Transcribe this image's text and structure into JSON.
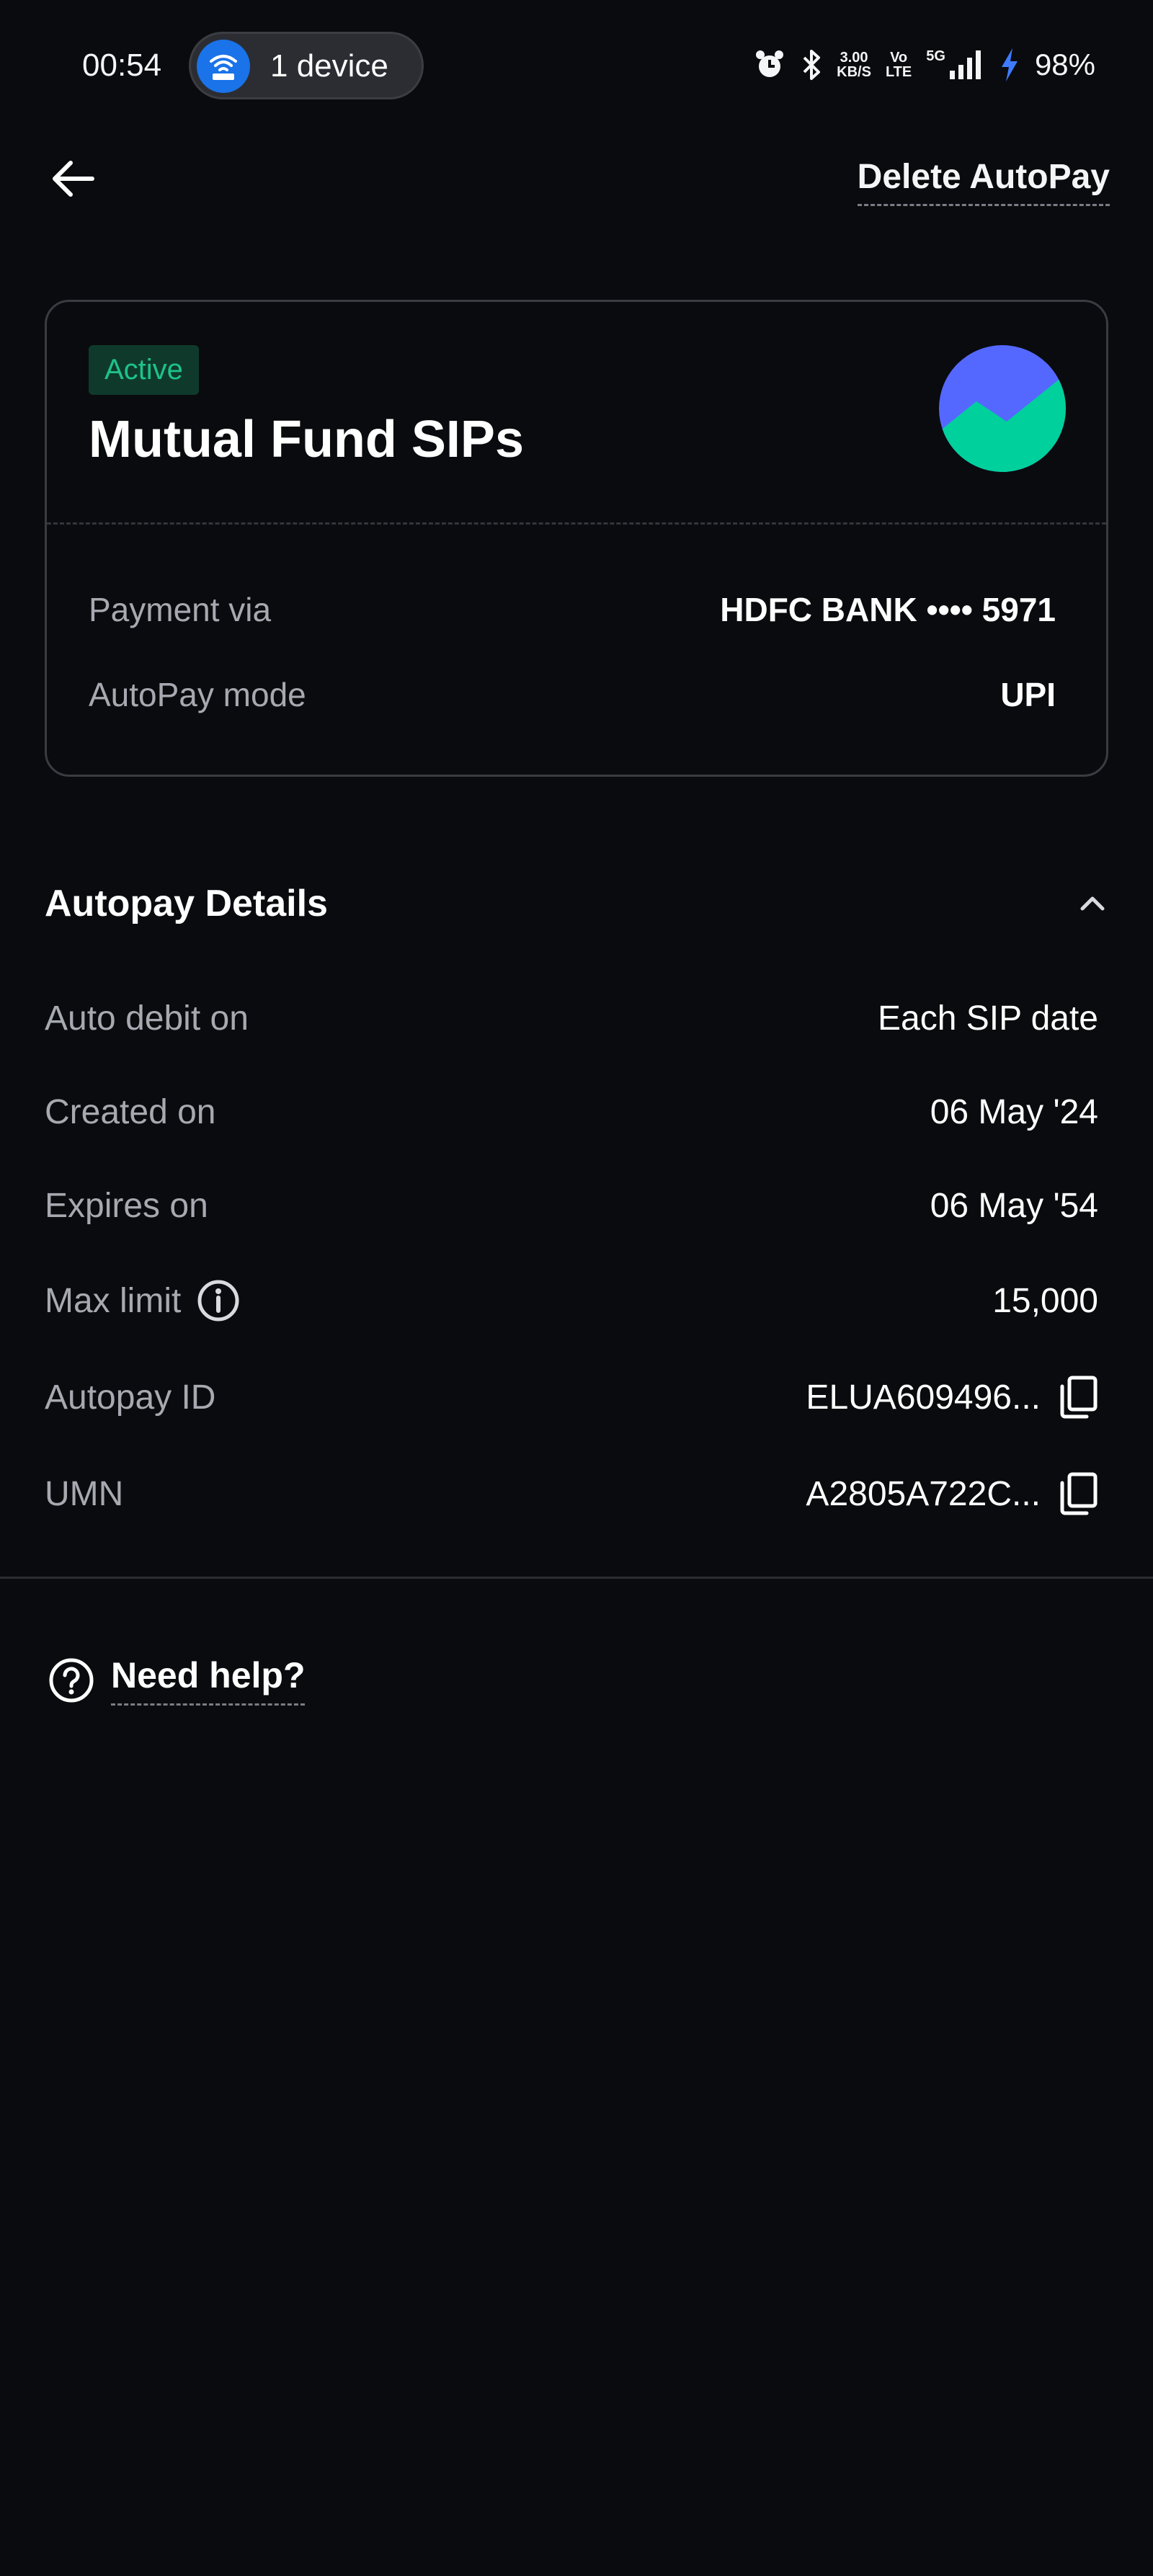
{
  "status_bar": {
    "time": "00:54",
    "hotspot_label": "1 device",
    "net_speed_value": "3.00",
    "net_speed_unit": "KB/S",
    "volte_top": "Vo",
    "volte_bottom": "LTE",
    "network_type": "5G",
    "battery": "98%"
  },
  "header": {
    "delete_label": "Delete AutoPay"
  },
  "card": {
    "status": "Active",
    "title": "Mutual Fund SIPs",
    "logo_colors": {
      "top": "#5468ff",
      "bottom": "#00d09c"
    },
    "rows": [
      {
        "label": "Payment via",
        "value": "HDFC BANK •••• 5971"
      },
      {
        "label": "AutoPay mode",
        "value": "UPI"
      }
    ]
  },
  "details": {
    "title": "Autopay Details",
    "rows": [
      {
        "label": "Auto debit on",
        "value": "Each SIP date"
      },
      {
        "label": "Created on",
        "value": "06 May '24"
      },
      {
        "label": "Expires on",
        "value": "06 May '54"
      },
      {
        "label": "Max limit",
        "value": "15,000",
        "icon": "info-icon"
      },
      {
        "label": "Autopay ID",
        "value": "ELUA609496...",
        "icon": "copy-icon"
      },
      {
        "label": "UMN",
        "value": "A2805A722C...",
        "icon": "copy-icon"
      }
    ]
  },
  "help": {
    "label": "Need help?"
  },
  "colors": {
    "background": "#0a0b0e",
    "active_green": "#1ec28b",
    "muted_text": "#a6a9b0"
  }
}
